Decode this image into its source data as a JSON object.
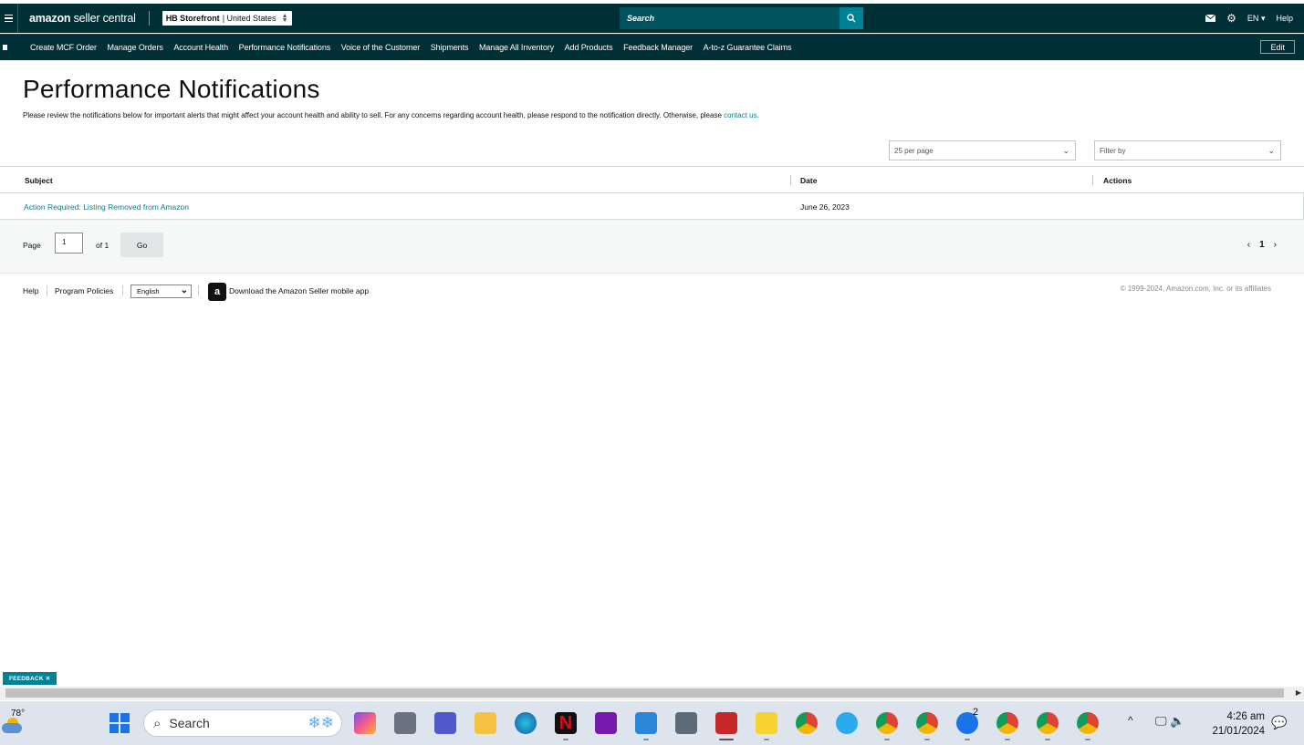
{
  "topbar": {
    "logo_brand": "amazon",
    "logo_product": "seller central",
    "store_name": "HB Storefront",
    "store_region": "| United States",
    "search_placeholder": "Search",
    "language": "EN",
    "help": "Help"
  },
  "nav": {
    "items": [
      "Create MCF Order",
      "Manage Orders",
      "Account Health",
      "Performance Notifications",
      "Voice of the Customer",
      "Shipments",
      "Manage All Inventory",
      "Add Products",
      "Feedback Manager",
      "A-to-z Guarantee Claims"
    ],
    "edit": "Edit"
  },
  "page": {
    "title": "Performance Notifications",
    "description": "Please review the notifications below for important alerts that might affect your account health and ability to sell. For any concerns regarding account health, please respond to the notification directly. Otherwise, please ",
    "contact_link": "contact us."
  },
  "controls": {
    "per_page": "25 per page",
    "filter_placeholder": "Filter by"
  },
  "table": {
    "headers": {
      "subject": "Subject",
      "date": "Date",
      "actions": "Actions"
    },
    "rows": [
      {
        "subject": "Action Required: Listing Removed from Amazon",
        "date": "June 26, 2023"
      }
    ]
  },
  "pager": {
    "page_label": "Page",
    "page_value": "1",
    "of_label": "of 1",
    "go": "Go",
    "prev": "‹",
    "current": "1",
    "next": "›"
  },
  "footer": {
    "help": "Help",
    "policies": "Program Policies",
    "language": "English",
    "app_text": "Download the Amazon Seller mobile app",
    "copyright": "© 1999-2024, Amazon.com, Inc. or its affiliates"
  },
  "feedback": "FEEDBACK ✕",
  "taskbar": {
    "temperature": "78°",
    "search": "Search",
    "time": "4:26 am",
    "date": "21/01/2024",
    "badge": "2"
  },
  "colors": {
    "header_bg": "#002f36",
    "accent": "#008296",
    "link": "#008296"
  }
}
